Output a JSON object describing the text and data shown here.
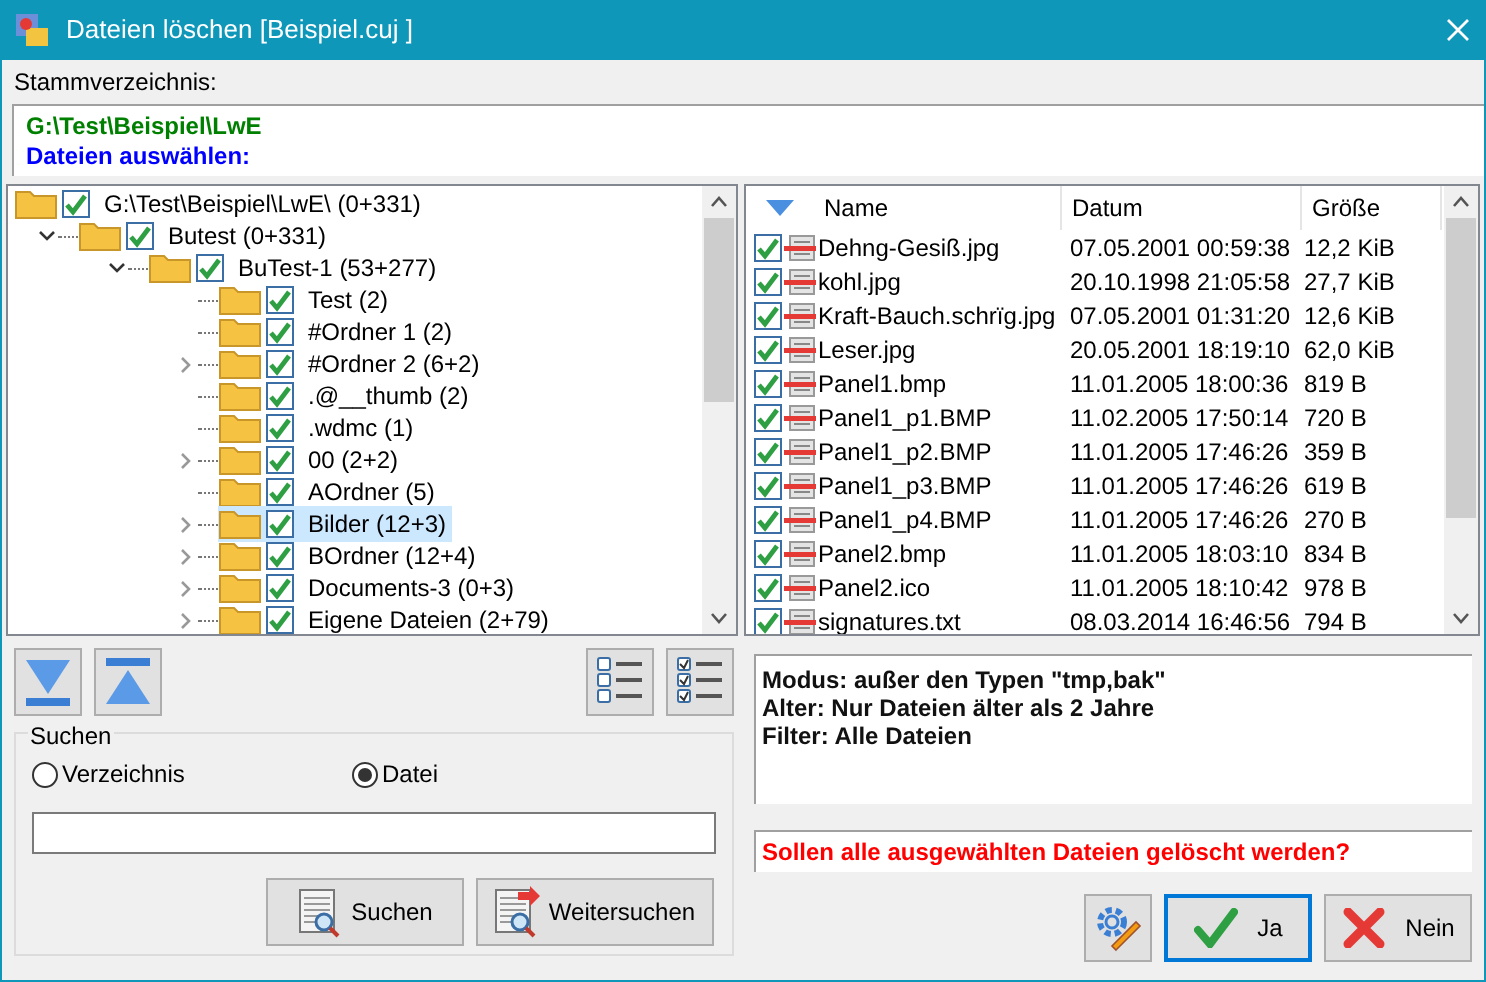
{
  "window": {
    "title": "Dateien löschen [Beispiel.cuj ]"
  },
  "root_dir": {
    "label": "Stammverzeichnis:",
    "path": "G:\\Test\\Beispiel\\LwE",
    "prompt": "Dateien auswählen:"
  },
  "tree": [
    {
      "label": "G:\\Test\\Beispiel\\LwE\\ (0+331)",
      "checked": true,
      "selected": false,
      "children": [
        {
          "label": "Butest (0+331)",
          "checked": true,
          "selected": false,
          "expanded": true,
          "children": [
            {
              "label": "BuTest-1 (53+277)",
              "checked": true,
              "selected": false,
              "expanded": true,
              "children": [
                {
                  "label": "Test (2)",
                  "checked": true,
                  "selected": false
                },
                {
                  "label": "#Ordner 1 (2)",
                  "checked": true,
                  "selected": false
                },
                {
                  "label": "#Ordner 2 (6+2)",
                  "checked": true,
                  "selected": false,
                  "expanded": false
                },
                {
                  "label": ".@__thumb (2)",
                  "checked": true,
                  "selected": false
                },
                {
                  "label": ".wdmc (1)",
                  "checked": true,
                  "selected": false
                },
                {
                  "label": "00 (2+2)",
                  "checked": true,
                  "selected": false,
                  "expanded": false
                },
                {
                  "label": "AOrdner (5)",
                  "checked": true,
                  "selected": false
                },
                {
                  "label": "Bilder (12+3)",
                  "checked": true,
                  "selected": true,
                  "expanded": false
                },
                {
                  "label": "BOrdner (12+4)",
                  "checked": true,
                  "selected": false,
                  "expanded": false
                },
                {
                  "label": "Documents-3 (0+3)",
                  "checked": true,
                  "selected": false,
                  "expanded": false
                },
                {
                  "label": "Eigene Dateien (2+79)",
                  "checked": true,
                  "selected": false,
                  "expanded": false
                }
              ]
            }
          ]
        }
      ]
    }
  ],
  "file_list": {
    "columns": [
      "Name",
      "Datum",
      "Größe"
    ],
    "rows": [
      {
        "checked": true,
        "name": "Dehng-Gesiß.jpg",
        "date": "07.05.2001 00:59:38",
        "size": "12,2 KiB"
      },
      {
        "checked": true,
        "name": "kohl.jpg",
        "date": "20.10.1998 21:05:58",
        "size": "27,7 KiB"
      },
      {
        "checked": true,
        "name": "Kraft-Bauch.schrïg.jpg",
        "date": "07.05.2001 01:31:20",
        "size": "12,6 KiB"
      },
      {
        "checked": true,
        "name": "Leser.jpg",
        "date": "20.05.2001 18:19:10",
        "size": "62,0 KiB"
      },
      {
        "checked": true,
        "name": "Panel1.bmp",
        "date": "11.01.2005 18:00:36",
        "size": "819 B"
      },
      {
        "checked": true,
        "name": "Panel1_p1.BMP",
        "date": "11.02.2005 17:50:14",
        "size": "720 B"
      },
      {
        "checked": true,
        "name": "Panel1_p2.BMP",
        "date": "11.01.2005 17:46:26",
        "size": "359 B"
      },
      {
        "checked": true,
        "name": "Panel1_p3.BMP",
        "date": "11.01.2005 17:46:26",
        "size": "619 B"
      },
      {
        "checked": true,
        "name": "Panel1_p4.BMP",
        "date": "11.01.2005 17:46:26",
        "size": "270 B"
      },
      {
        "checked": true,
        "name": "Panel2.bmp",
        "date": "11.01.2005 18:03:10",
        "size": "834 B"
      },
      {
        "checked": true,
        "name": "Panel2.ico",
        "date": "11.01.2005 18:10:42",
        "size": "978 B"
      },
      {
        "checked": true,
        "name": "signatures.txt",
        "date": "08.03.2014 16:46:56",
        "size": "794 B"
      }
    ]
  },
  "search": {
    "title": "Suchen",
    "options": [
      {
        "label": "Verzeichnis",
        "selected": false
      },
      {
        "label": "Datei",
        "selected": true
      }
    ],
    "buttons": [
      "Suchen",
      "Weitersuchen"
    ]
  },
  "info": [
    "Modus: außer den Typen \"tmp,bak\"",
    "Alter: Nur Dateien älter als 2 Jahre",
    "Filter: Alle Dateien"
  ],
  "question": "Sollen alle ausgewählten Dateien gelöscht werden?",
  "buttons": [
    {
      "label": "Ja",
      "default": true,
      "kind": "yes"
    },
    {
      "label": "Nein",
      "default": false,
      "kind": "no"
    }
  ]
}
